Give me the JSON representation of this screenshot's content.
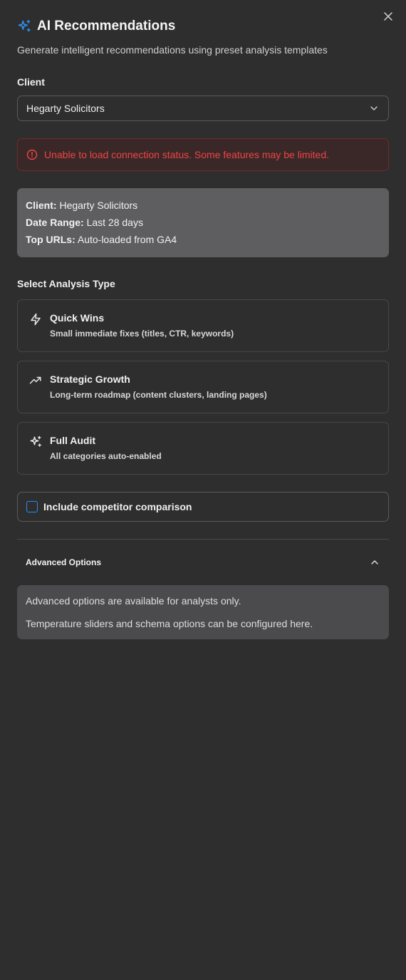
{
  "header": {
    "title": "AI Recommendations",
    "subtitle": "Generate intelligent recommendations using preset analysis templates",
    "icon": "sparkles-icon",
    "accent_color": "#2f8ae8"
  },
  "client_field": {
    "label": "Client",
    "selected": "Hegarty Solicitors"
  },
  "alert": {
    "message": "Unable to load connection status. Some features may be limited.",
    "color": "#ef4444"
  },
  "info": {
    "client_label": "Client:",
    "client_value": "Hegarty Solicitors",
    "date_label": "Date Range:",
    "date_value": "Last 28 days",
    "urls_label": "Top URLs:",
    "urls_value": "Auto-loaded from GA4"
  },
  "analysis": {
    "label": "Select Analysis Type",
    "options": [
      {
        "title": "Quick Wins",
        "description": "Small immediate fixes (titles, CTR, keywords)",
        "icon": "lightning-icon"
      },
      {
        "title": "Strategic Growth",
        "description": "Long-term roadmap (content clusters, landing pages)",
        "icon": "trending-up-icon"
      },
      {
        "title": "Full Audit",
        "description": "All categories auto-enabled",
        "icon": "sparkles-icon"
      }
    ]
  },
  "competitor": {
    "label": "Include competitor comparison",
    "checked": false
  },
  "advanced": {
    "title": "Advanced Options",
    "expanded": true,
    "line1": "Advanced options are available for analysts only.",
    "line2": "Temperature sliders and schema options can be configured here."
  }
}
